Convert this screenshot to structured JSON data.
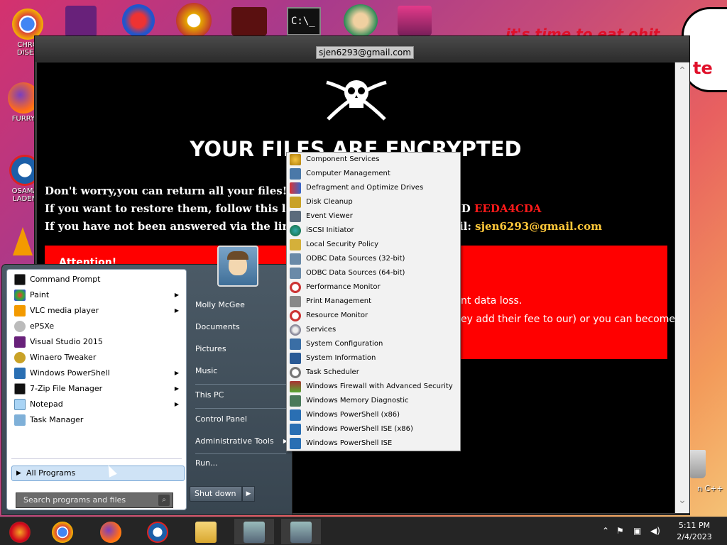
{
  "desktop": {
    "icons": [
      {
        "name": "chrome",
        "label1": "CHRO",
        "label2": "DISEA"
      },
      {
        "name": "firefox",
        "label1": "FURRY",
        "label2": ""
      },
      {
        "name": "obama",
        "label1": "OSAMA",
        "label2": "LADEN"
      }
    ],
    "bubble_text": "it's time to eat ohit",
    "bubble_text2": "te",
    "right_text": "n C++"
  },
  "window": {
    "title_email": "sjen6293@gmail.com",
    "headline": "YOUR FILES ARE ENCRYPTED",
    "line1": "Don't worry,you can return all your files!",
    "line2_a": "If you want to restore them, follow this link:",
    "line2_b": "e",
    "line2_c": "R ID",
    "line2_id": "EEDA4CDA",
    "line3_a": "If you have not been answered via the link wit",
    "line3_b": "il:",
    "line3_email": "sjen6293@gmail.com",
    "attention": "Attention!",
    "red_line1": "nt data loss.",
    "red_line2": "ey add their fee to our) or you can become"
  },
  "start_menu": {
    "left_items": [
      {
        "label": "Command Prompt",
        "arrow": ""
      },
      {
        "label": "Paint",
        "arrow": "▶"
      },
      {
        "label": "VLC media player",
        "arrow": "▶"
      },
      {
        "label": "ePSXe",
        "arrow": ""
      },
      {
        "label": "Visual Studio 2015",
        "arrow": ""
      },
      {
        "label": "Winaero Tweaker",
        "arrow": ""
      },
      {
        "label": "Windows PowerShell",
        "arrow": "▶"
      },
      {
        "label": "7-Zip File Manager",
        "arrow": "▶"
      },
      {
        "label": "Notepad",
        "arrow": "▶"
      },
      {
        "label": "Task Manager",
        "arrow": ""
      }
    ],
    "all_programs": "All Programs",
    "search_placeholder": "Search programs and files",
    "right_links": {
      "user": "Molly McGee",
      "documents": "Documents",
      "pictures": "Pictures",
      "music": "Music",
      "this_pc": "This PC",
      "control_panel": "Control Panel",
      "admin_tools": "Administrative Tools",
      "admin_arrow": "▶",
      "run": "Run..."
    },
    "shutdown": "Shut down",
    "shutdown_arrow": "▶"
  },
  "admin_submenu": [
    "Component Services",
    "Computer Management",
    "Defragment and Optimize Drives",
    "Disk Cleanup",
    "Event Viewer",
    "iSCSI Initiator",
    "Local Security Policy",
    "ODBC Data Sources (32-bit)",
    "ODBC Data Sources (64-bit)",
    "Performance Monitor",
    "Print Management",
    "Resource Monitor",
    "Services",
    "System Configuration",
    "System Information",
    "Task Scheduler",
    "Windows Firewall with Advanced Security",
    "Windows Memory Diagnostic",
    "Windows PowerShell (x86)",
    "Windows PowerShell ISE (x86)",
    "Windows PowerShell ISE"
  ],
  "taskbar": {
    "time": "5:11 PM",
    "date": "2/4/2023"
  },
  "colors": {
    "ransom_red": "#ff0000",
    "id_red": "#ff1a1a",
    "email_gold": "#ffc83a",
    "taskbar": "#252525"
  }
}
